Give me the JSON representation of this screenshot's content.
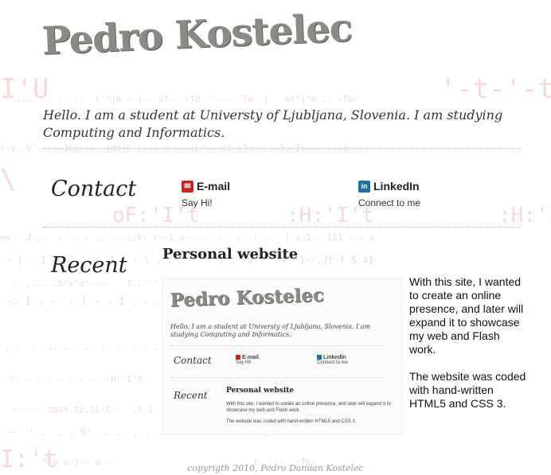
{
  "header": {
    "title": "Pedro Kostelec",
    "intro": "Hello. I am a student at Universty of Ljubljana, Slovenia. I am studying Computing and Informatics."
  },
  "contact": {
    "heading": "Contact",
    "email": {
      "label": "E-mail",
      "sub": "Say Hi!",
      "icon": "mail-icon"
    },
    "linkedin": {
      "label": "LinkedIn",
      "sub": "Connect to me",
      "icon": "linkedin-icon"
    }
  },
  "recent": {
    "heading": "Recent",
    "project": {
      "title": "Personal website",
      "desc1": "With this site, I wanted to create an online presence, and later will expand it to showcase my web and Flash work.",
      "desc2": "The website was coded with hand-written HTML5 and CSS 3.",
      "thumbnail": {
        "title": "Pedro Kostelec",
        "intro": "Hello. I am a student at Universty of Ljubljana, Slovenia. I am studying Computing and Informatics.",
        "contact": "Contact",
        "email": "E-mail",
        "email_sub": "Say Hi!",
        "linkedin": "LinkedIn",
        "linkedin_sub": "Connect to me",
        "recent": "Recent",
        "project": "Personal website",
        "desc1": "With this site, I wanted to create an online presence, and later will expand it to showcase my web and Flash work.",
        "desc2": "The website was coded with hand-written HTML5 and CSS 3."
      }
    }
  },
  "footer": {
    "text": "copyrigth 2010, Pedro Damian Kostelec"
  },
  "colors": {
    "email_icon": "#c8241e",
    "linkedin_icon": "#1e6fa8",
    "background_art": "#f4b9b9"
  }
}
